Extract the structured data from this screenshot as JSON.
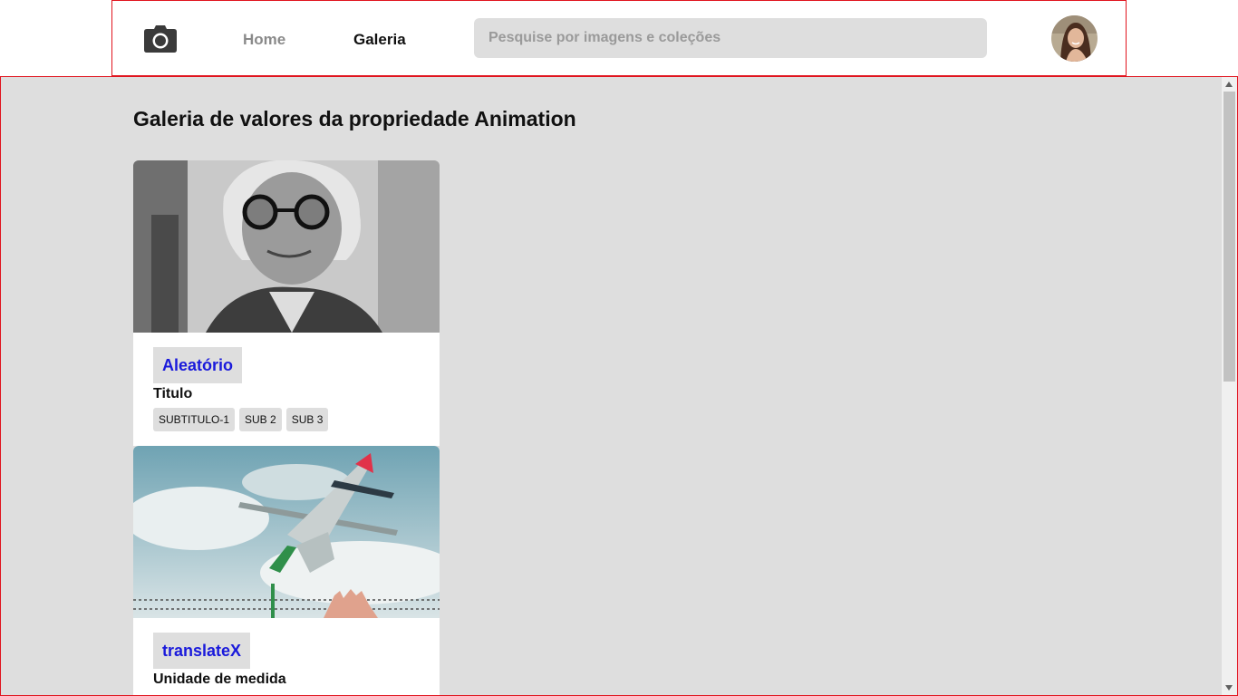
{
  "header": {
    "logo_icon": "camera-icon",
    "nav": {
      "home_label": "Home",
      "gallery_label": "Galeria"
    },
    "search": {
      "placeholder": "Pesquise por imagens e coleções",
      "value": ""
    },
    "avatar_icon": "user-avatar"
  },
  "main": {
    "title": "Galeria de valores da propriedade Animation",
    "cards": [
      {
        "image_icon": "portrait-photo",
        "tag": "Aleatório",
        "title": "Titulo",
        "chips": [
          "SUBTITULO-1",
          "SUB 2",
          "SUB 3"
        ]
      },
      {
        "image_icon": "airplane-photo",
        "tag": "translateX",
        "title": "Unidade de medida",
        "chips": []
      }
    ]
  },
  "colors": {
    "accent_border": "#e0141e",
    "tag_text": "#1a1adb",
    "content_bg": "#dedede"
  }
}
